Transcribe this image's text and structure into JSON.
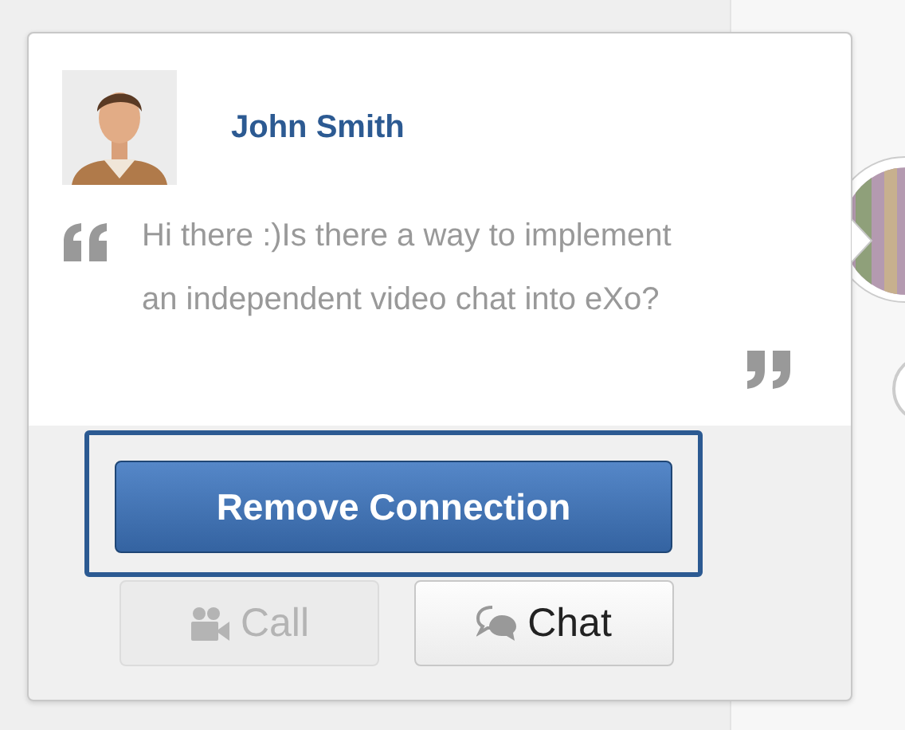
{
  "popover": {
    "person": {
      "name": "John Smith"
    },
    "message": "Hi there :)Is there a way to implement an independent video chat into eXo?",
    "primary_button": {
      "label": "Remove Connection",
      "focused": true
    },
    "buttons": [
      {
        "kind": "call",
        "label": "Call",
        "disabled": true
      },
      {
        "kind": "chat",
        "label": "Chat",
        "disabled": false
      }
    ]
  }
}
